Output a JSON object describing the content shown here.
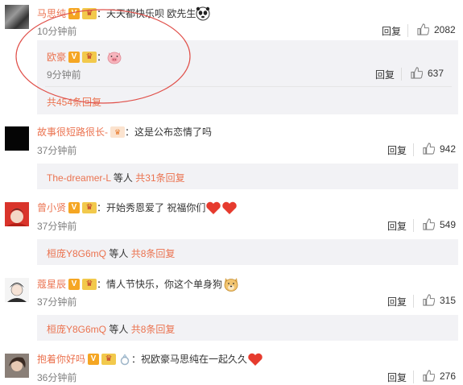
{
  "comments": [
    {
      "name": "马思纯",
      "text": "：天天都快乐呗 欧先生",
      "time": "10分钟前",
      "reply_label": "回复",
      "likes": "2082",
      "sub_reply": {
        "name": "欧豪",
        "text": "：",
        "time": "9分钟前",
        "reply_label": "回复",
        "likes": "637"
      },
      "more_replies": "共454条回复"
    },
    {
      "name": "故事很短路很长-",
      "text": "：这是公布恋情了吗",
      "time": "37分钟前",
      "reply_label": "回复",
      "likes": "942",
      "summary_user": "The-dreamer-L",
      "summary_mid": " 等人 ",
      "summary_count": "共31条回复"
    },
    {
      "name": "曾小贤",
      "text": "：开始秀恩爱了  祝福你们",
      "time": "37分钟前",
      "reply_label": "回复",
      "likes": "549",
      "summary_user": "桓庞Y8G6mQ",
      "summary_mid": " 等人 ",
      "summary_count": "共8条回复"
    },
    {
      "name": "蔻星辰",
      "text": "：情人节快乐，你这个单身狗",
      "time": "37分钟前",
      "reply_label": "回复",
      "likes": "315",
      "summary_user": "桓庞Y8G6mQ",
      "summary_mid": " 等人 ",
      "summary_count": "共8条回复"
    },
    {
      "name": "抱着你好吗",
      "text": "：祝欧豪马思纯在一起久久",
      "time": "36分钟前",
      "reply_label": "回复",
      "likes": "276"
    }
  ],
  "colors": {
    "name": "#eb7350",
    "panel": "#f2f2f5",
    "annotation_circle": "#e0504a",
    "heart": "#e63b2e"
  },
  "icons": [
    "thumb-up-icon",
    "verified-v-icon",
    "vip-crown-icon",
    "panda-emoji-icon",
    "pig-emoji-icon",
    "heart-emoji-icon",
    "doge-emoji-icon",
    "ring-icon"
  ]
}
